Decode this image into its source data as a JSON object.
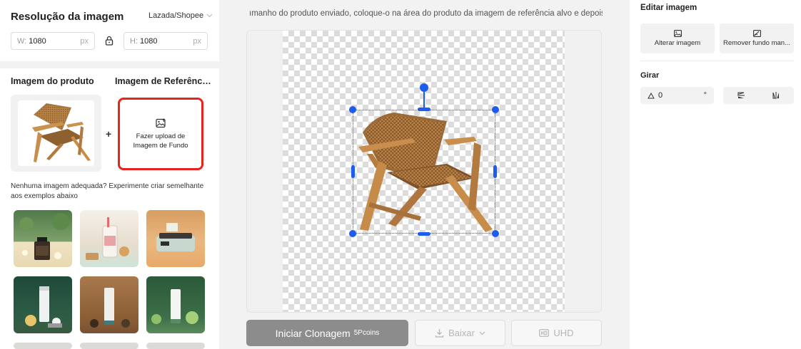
{
  "left_panel": {
    "resolution_title": "Resolução da imagem",
    "preset": "Lazada/Shopee",
    "width_label": "W:",
    "width_value": "1080",
    "height_label": "H:",
    "height_value": "1080",
    "unit": "px",
    "product_label": "Imagem do produto",
    "reference_label": "Imagem de Referência...",
    "upload_line1": "Fazer upload de",
    "upload_line2": "Imagem de Fundo",
    "plus": "+",
    "hint": "Nenhuma imagem adequada? Experimente criar semelhante aos exemplos abaixo"
  },
  "center": {
    "instruction": "ımanho do produto enviado, coloque-o na área do produto da imagem de referência alvo e depois c",
    "start_button": "Iniciar Clonagem",
    "start_cost": "5Pcoins",
    "download_button": "Baixar",
    "uhd_button": "UHD"
  },
  "right_panel": {
    "title": "Editar imagem",
    "change_image": "Alterar imagem",
    "remove_bg": "Remover fundo man...",
    "rotate_title": "Girar",
    "rotate_value": "0",
    "degree_symbol": "°"
  },
  "colors": {
    "accent": "#1c5cf0",
    "highlight": "#e7231b",
    "primary_disabled": "#8c8c8c"
  },
  "icons": [
    "lock-icon",
    "image-upload-icon",
    "download-icon",
    "chevron-down-icon",
    "hd-icon",
    "image-icon",
    "image-edit-icon",
    "angle-icon",
    "flip-vertical-icon",
    "flip-horizontal-icon"
  ]
}
